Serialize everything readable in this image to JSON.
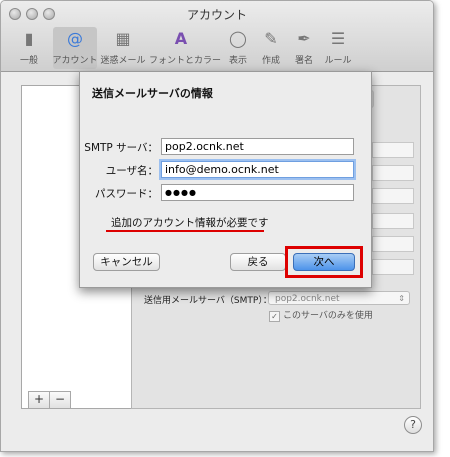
{
  "window": {
    "title": "アカウント"
  },
  "toolbar": {
    "items": [
      {
        "label": "一般",
        "icon": "switch-icon"
      },
      {
        "label": "アカウント",
        "icon": "at-sign-icon"
      },
      {
        "label": "迷惑メール",
        "icon": "trash-bin-icon"
      },
      {
        "label": "フォントとカラー",
        "icon": "fonts-colors-icon"
      },
      {
        "label": "表示",
        "icon": "glasses-icon"
      },
      {
        "label": "作成",
        "icon": "pencil-paper-icon"
      },
      {
        "label": "署名",
        "icon": "signature-pen-icon"
      },
      {
        "label": "ルール",
        "icon": "rules-icon"
      }
    ],
    "selected": "アカウント"
  },
  "sheet": {
    "title": "送信メールサーバの情報",
    "fields": {
      "smtp_label": "SMTP サーバ：",
      "smtp_value": "pop2.ocnk.net",
      "user_label": "ユーザ名：",
      "user_value": "info@demo.ocnk.net",
      "password_label": "パスワード：",
      "password_value": "●●●●"
    },
    "notice": "追加のアカウント情報が必要です",
    "buttons": {
      "cancel": "キャンセル",
      "back": "戻る",
      "next": "次へ"
    }
  },
  "detail": {
    "smtp_label": "送信用メールサーバ（SMTP）：",
    "smtp_value": "pop2.ocnk.net",
    "only_server_label": "このサーバのみを使用"
  },
  "account_list": {
    "add_label": "+",
    "remove_label": "−"
  },
  "help_label": "?",
  "colors": {
    "accent_blue": "#4d93ea",
    "highlight_red": "#dd0000"
  }
}
